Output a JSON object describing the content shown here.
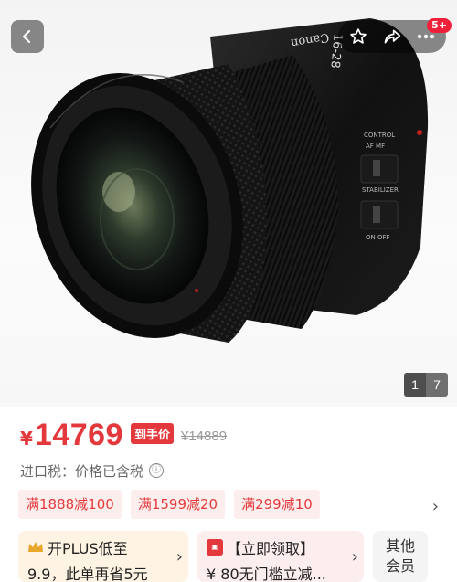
{
  "header": {
    "back_icon": "chevron-left-icon",
    "favorite_icon": "star-outline-icon",
    "share_icon": "share-arrow-icon",
    "more_icon": "more-dots-icon",
    "notification_badge": "5+"
  },
  "gallery": {
    "lens_markings": {
      "brand": "Canon",
      "focal": "16-28",
      "control_label": "CONTROL",
      "control_modes": "AF MF",
      "stabilizer_label": "STABILIZER",
      "stabilizer_modes": "ON OFF"
    },
    "pager": {
      "current": "1",
      "total": "7"
    }
  },
  "price": {
    "currency": "¥",
    "value": "14769",
    "tag": "到手价",
    "original": "¥14889"
  },
  "tax": {
    "label": "进口税：",
    "value": "价格已含税",
    "info_icon": "ⓘ"
  },
  "coupons": [
    {
      "label": "满1888减100"
    },
    {
      "label": "满1599减20"
    },
    {
      "label": "满299减10"
    }
  ],
  "promotions": {
    "plus": {
      "line1": "开PLUS低至",
      "line2": "9.9，此单再省5元"
    },
    "coupon_claim": {
      "line1": "【立即领取】",
      "line2": "¥ 80无门槛立减..."
    },
    "other": {
      "line1": "其他",
      "line2": "会员"
    }
  },
  "colors": {
    "accent_red": "#e4393c",
    "badge_red": "#f0203a"
  }
}
